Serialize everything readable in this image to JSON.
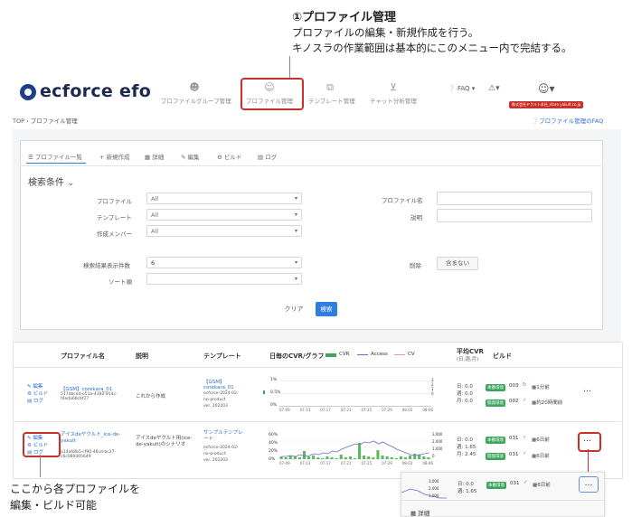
{
  "annotation_top": {
    "title": "①プロファイル管理",
    "line1": "プロファイルの編集・新規作成を行う。",
    "line2": "キノスラの作業範囲は基本的にこのメニュー内で完結する。"
  },
  "annotation_bottom": {
    "line1": "ここから各プロファイルを",
    "line2": "編集・ビルド可能"
  },
  "header": {
    "logo": "ecforce efo",
    "nav": [
      {
        "label": "プロファイルグループ管理",
        "icon": "users-icon"
      },
      {
        "label": "プロファイル管理",
        "icon": "user-icon"
      },
      {
        "label": "テンプレート管理",
        "icon": "template-icon"
      },
      {
        "label": "チャット分析管理",
        "icon": "analytics-icon"
      }
    ],
    "faq": "FAQ",
    "user_email": "株式会社ヤクルト本社_store.yakult.co.jp"
  },
  "breadcrumb": "TOP › プロファイル管理",
  "faq_link": "プロファイル管理のFAQ",
  "tabs": [
    "プロファイル一覧",
    "+ 新規作成",
    "詳細",
    "編集",
    "ビルド",
    "ログ"
  ],
  "search": {
    "heading": "検索条件",
    "fields": [
      {
        "label": "プロファイル",
        "value": "All"
      },
      {
        "label": "テンプレート",
        "value": "All"
      },
      {
        "label": "作成メンバー",
        "value": "All"
      }
    ],
    "right_fields": [
      {
        "label": "プロファイル名",
        "value": ""
      },
      {
        "label": "説明",
        "value": ""
      }
    ],
    "results_label": "検索結果表示件数",
    "results_value": "6",
    "sort_label": "ソート順",
    "sort_value": "",
    "delete_label": "削除",
    "delete_value": "含まない",
    "clear": "クリア",
    "search": "検索"
  },
  "table": {
    "headers": {
      "name": "プロファイル名",
      "desc": "説明",
      "template": "テンプレート",
      "graph": "日毎のCVR/グラフ",
      "legend_cvr": "CVR",
      "legend_access": "Access",
      "legend_cv": "CV",
      "avg_cvr": "平均CVR",
      "avg_sub": "(日,週,月)",
      "build": "ビルド"
    },
    "actions": {
      "edit": "編集",
      "build": "ビルド",
      "log": "ログ"
    },
    "rows": [
      {
        "name": "【GSM】corekara_01",
        "id": "517dbce4-e51a-4382-814c-f4eda66cbf27",
        "desc": "これから作成",
        "template": "【GSM】corekara_01",
        "template_meta1": "ecforce-2024-02-",
        "template_meta2": "no-product",
        "template_meta3": "ver. 202203",
        "y_ticks": [
          "1%",
          "0.5%",
          "0%"
        ],
        "y2_ticks": [
          "3",
          "2",
          "1",
          "0"
        ],
        "x_ticks": [
          "07-09",
          "07-13",
          "07-17",
          "07-21",
          "07-25",
          "07-29",
          "08-02",
          "08-06"
        ],
        "cvr_day": "日: 0.0",
        "cvr_week": "週: 0.0",
        "cvr_month": "月: 0.0",
        "build1_badge": "本番環境",
        "build1_num": "003",
        "build1_time": "1分前",
        "build2_badge": "開発環境",
        "build2_num": "002",
        "build2_time": "約20時間前"
      },
      {
        "name": "アイスdeヤクルト_ice-de-yakult",
        "id": "a14a68b5-cf90-46cd-bc27-c6c080d05649",
        "desc": "アイスdeヤクルト用(ice-de-yakult)のシナリオ",
        "template": "サンプルテンプレート",
        "template_meta1": "ecforce-2024-02-",
        "template_meta2": "no-product",
        "template_meta3": "ver. 202203",
        "y_ticks": [
          "60%",
          "40%",
          "20%",
          "0%"
        ],
        "y2_ticks": [
          "3,000",
          "2,000",
          "1,000",
          "0"
        ],
        "x_ticks": [
          "07-09",
          "07-13",
          "07-17",
          "07-21",
          "07-25",
          "07-29",
          "08-02",
          "08-06"
        ],
        "cvr_day": "日: 0.0",
        "cvr_week": "週: 1.65",
        "cvr_month": "月: 2.45",
        "build1_badge": "本番環境",
        "build1_num": "031",
        "build1_time": "6日前",
        "build2_badge": "開発環境",
        "build2_num": "031",
        "build2_time": "6日前"
      }
    ]
  },
  "zoom_inset": {
    "y2_ticks": [
      "3,000",
      "2,000",
      "1,000"
    ],
    "cvr_day": "日: 0.0",
    "cvr_week": "週: 1.65",
    "badge": "本番環境",
    "num": "031",
    "time": "6日前",
    "menu_item": "詳細"
  },
  "more_label": "…"
}
